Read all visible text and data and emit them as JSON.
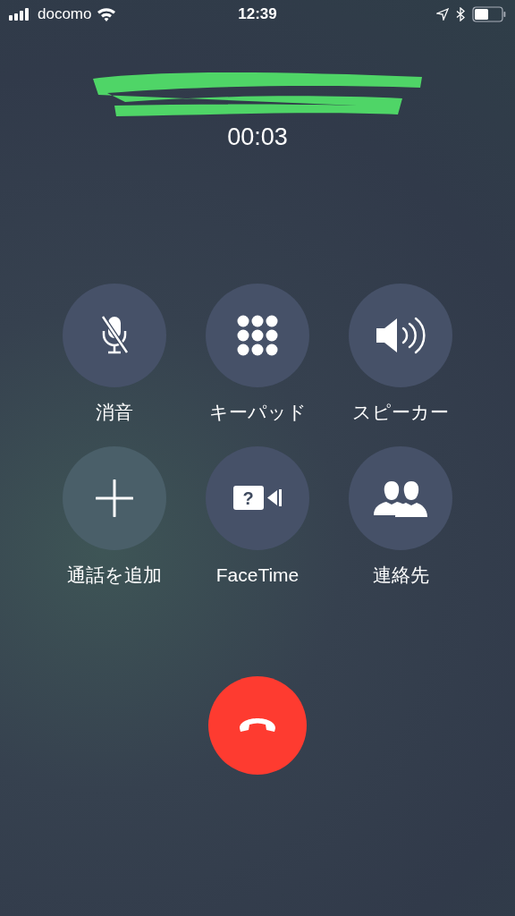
{
  "status_bar": {
    "carrier": "docomo",
    "time": "12:39"
  },
  "call": {
    "duration": "00:03"
  },
  "buttons": [
    {
      "kind": "mute",
      "label": "消音"
    },
    {
      "kind": "keypad",
      "label": "キーパッド"
    },
    {
      "kind": "speaker",
      "label": "スピーカー"
    },
    {
      "kind": "add",
      "label": "通話を追加"
    },
    {
      "kind": "facetime",
      "label": "FaceTime",
      "glyph": "?"
    },
    {
      "kind": "contacts",
      "label": "連絡先"
    }
  ]
}
